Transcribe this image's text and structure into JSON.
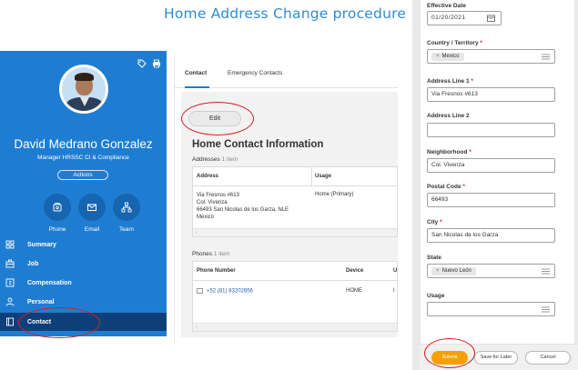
{
  "title": "Home Address Change procedure",
  "profile": {
    "name": "David Medrano Gonzalez",
    "role": "Manager HRSSC CI & Compliance",
    "actions_label": "Actions",
    "quick_actions": [
      {
        "label": "Phone",
        "icon": "phone-icon"
      },
      {
        "label": "Email",
        "icon": "mail-icon"
      },
      {
        "label": "Team",
        "icon": "team-icon"
      }
    ],
    "nav": [
      {
        "label": "Summary",
        "icon": "summary-icon"
      },
      {
        "label": "Job",
        "icon": "job-icon"
      },
      {
        "label": "Compensation",
        "icon": "compensation-icon"
      },
      {
        "label": "Personal",
        "icon": "person-icon"
      },
      {
        "label": "Contact",
        "icon": "contact-icon",
        "active": true
      }
    ]
  },
  "contact": {
    "tabs": [
      "Contact",
      "Emergency Contacts"
    ],
    "edit_label": "Edit",
    "heading": "Home Contact Information",
    "addresses": {
      "label": "Addresses",
      "count": "1 item",
      "columns": [
        "Address",
        "Usage"
      ],
      "rows": [
        {
          "address_lines": [
            "Via Fresnos #613",
            "Col. Vivenza",
            "66493 San Nicolas de los Garza, NLE",
            "Mexico"
          ],
          "usage": "Home (Primary)"
        }
      ]
    },
    "phones": {
      "label": "Phones",
      "count": "1 item",
      "columns": [
        "Phone Number",
        "Device",
        "U"
      ],
      "rows": [
        {
          "number": "+52 (81) 83202656",
          "device": "HOME",
          "usage": "I"
        }
      ]
    }
  },
  "form": {
    "effective_date": {
      "label": "Effective Date",
      "value": "01/20/2021"
    },
    "country": {
      "label": "Country / Territory",
      "value": "Mexico"
    },
    "address1": {
      "label": "Address Line 1",
      "value": "Via Fresnos #613"
    },
    "address2": {
      "label": "Address Line 2",
      "value": ""
    },
    "neighborhood": {
      "label": "Neighborhood",
      "value": "Col. Vivenza"
    },
    "postal": {
      "label": "Postal Code",
      "value": "66493"
    },
    "city": {
      "label": "City",
      "value": "San Nicolas de los Garza"
    },
    "state": {
      "label": "State",
      "value": "Nuevo León"
    },
    "usage": {
      "label": "Usage",
      "value": ""
    },
    "required_mark": "*"
  },
  "footer": {
    "submit": "Submit",
    "save_later": "Save for Later",
    "cancel": "Cancel"
  },
  "colors": {
    "brand_blue": "#1f7dd1",
    "nav_active": "#0f3f7a",
    "submit_orange": "#f5a000",
    "required_red": "#d21f1f",
    "title_blue": "#2f8ccf"
  }
}
